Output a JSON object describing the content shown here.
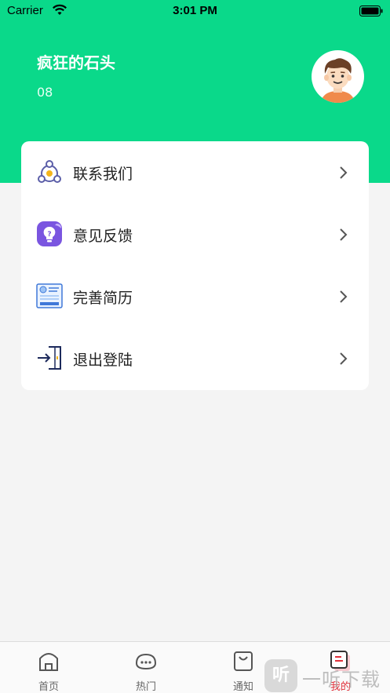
{
  "status_bar": {
    "carrier": "Carrier",
    "time": "3:01 PM",
    "wifi_icon": "wifi-icon",
    "battery_icon": "battery-icon"
  },
  "profile": {
    "name": "疯狂的石头",
    "id": "08",
    "avatar_icon": "avatar-boy-icon"
  },
  "menu": [
    {
      "label": "联系我们",
      "icon": "contact-network-icon"
    },
    {
      "label": "意见反馈",
      "icon": "feedback-lightbulb-icon"
    },
    {
      "label": "完善简历",
      "icon": "resume-icon"
    },
    {
      "label": "退出登陆",
      "icon": "logout-door-icon"
    }
  ],
  "tabs": [
    {
      "label": "首页",
      "icon": "home-icon",
      "active": false
    },
    {
      "label": "热门",
      "icon": "hot-chat-icon",
      "active": false
    },
    {
      "label": "通知",
      "icon": "bag-icon",
      "active": false
    },
    {
      "label": "我的",
      "icon": "profile-card-icon",
      "active": true
    }
  ],
  "watermark": {
    "logo_text": "听",
    "text": "一听下载"
  },
  "colors": {
    "header_green": "#0ad98a",
    "active_tab": "#e0303a",
    "background": "#f4f4f4"
  }
}
